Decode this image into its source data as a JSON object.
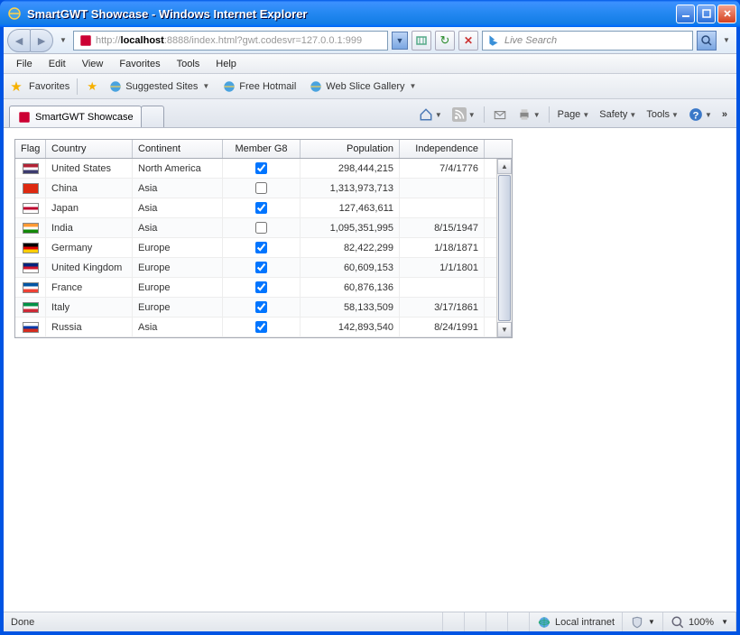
{
  "window": {
    "title": "SmartGWT Showcase - Windows Internet Explorer"
  },
  "nav": {
    "url_proto": "http://",
    "url_host": "localhost",
    "url_path": ":8888/index.html?gwt.codesvr=127.0.0.1:999",
    "search_placeholder": "Live Search"
  },
  "menu": {
    "file": "File",
    "edit": "Edit",
    "view": "View",
    "favorites": "Favorites",
    "tools": "Tools",
    "help": "Help"
  },
  "favbar": {
    "favorites": "Favorites",
    "suggested": "Suggested Sites",
    "hotmail": "Free Hotmail",
    "slice": "Web Slice Gallery"
  },
  "tabs": {
    "active": "SmartGWT Showcase"
  },
  "cmds": {
    "page": "Page",
    "safety": "Safety",
    "tools": "Tools"
  },
  "grid": {
    "headers": {
      "flag": "Flag",
      "country": "Country",
      "continent": "Continent",
      "g8": "Member G8",
      "pop": "Population",
      "ind": "Independence"
    },
    "rows": [
      {
        "flag_colors": [
          "#b22234",
          "#ffffff",
          "#3c3b6e"
        ],
        "country": "United States",
        "continent": "North America",
        "g8": true,
        "pop": "298,444,215",
        "ind": "7/4/1776"
      },
      {
        "flag_colors": [
          "#de2910",
          "#de2910",
          "#de2910"
        ],
        "country": "China",
        "continent": "Asia",
        "g8": false,
        "pop": "1,313,973,713",
        "ind": ""
      },
      {
        "flag_colors": [
          "#ffffff",
          "#bc002d",
          "#ffffff"
        ],
        "country": "Japan",
        "continent": "Asia",
        "g8": true,
        "pop": "127,463,611",
        "ind": ""
      },
      {
        "flag_colors": [
          "#ff9933",
          "#ffffff",
          "#138808"
        ],
        "country": "India",
        "continent": "Asia",
        "g8": false,
        "pop": "1,095,351,995",
        "ind": "8/15/1947"
      },
      {
        "flag_colors": [
          "#000000",
          "#dd0000",
          "#ffce00"
        ],
        "country": "Germany",
        "continent": "Europe",
        "g8": true,
        "pop": "82,422,299",
        "ind": "1/18/1871"
      },
      {
        "flag_colors": [
          "#00247d",
          "#cf142b",
          "#ffffff"
        ],
        "country": "United Kingdom",
        "continent": "Europe",
        "g8": true,
        "pop": "60,609,153",
        "ind": "1/1/1801"
      },
      {
        "flag_colors": [
          "#0055a4",
          "#ffffff",
          "#ef4135"
        ],
        "country": "France",
        "continent": "Europe",
        "g8": true,
        "pop": "60,876,136",
        "ind": ""
      },
      {
        "flag_colors": [
          "#009246",
          "#ffffff",
          "#ce2b37"
        ],
        "country": "Italy",
        "continent": "Europe",
        "g8": true,
        "pop": "58,133,509",
        "ind": "3/17/1861"
      },
      {
        "flag_colors": [
          "#ffffff",
          "#0039a6",
          "#d52b1e"
        ],
        "country": "Russia",
        "continent": "Asia",
        "g8": true,
        "pop": "142,893,540",
        "ind": "8/24/1991"
      }
    ]
  },
  "status": {
    "left": "Done",
    "zone": "Local intranet",
    "zoom": "100%"
  }
}
